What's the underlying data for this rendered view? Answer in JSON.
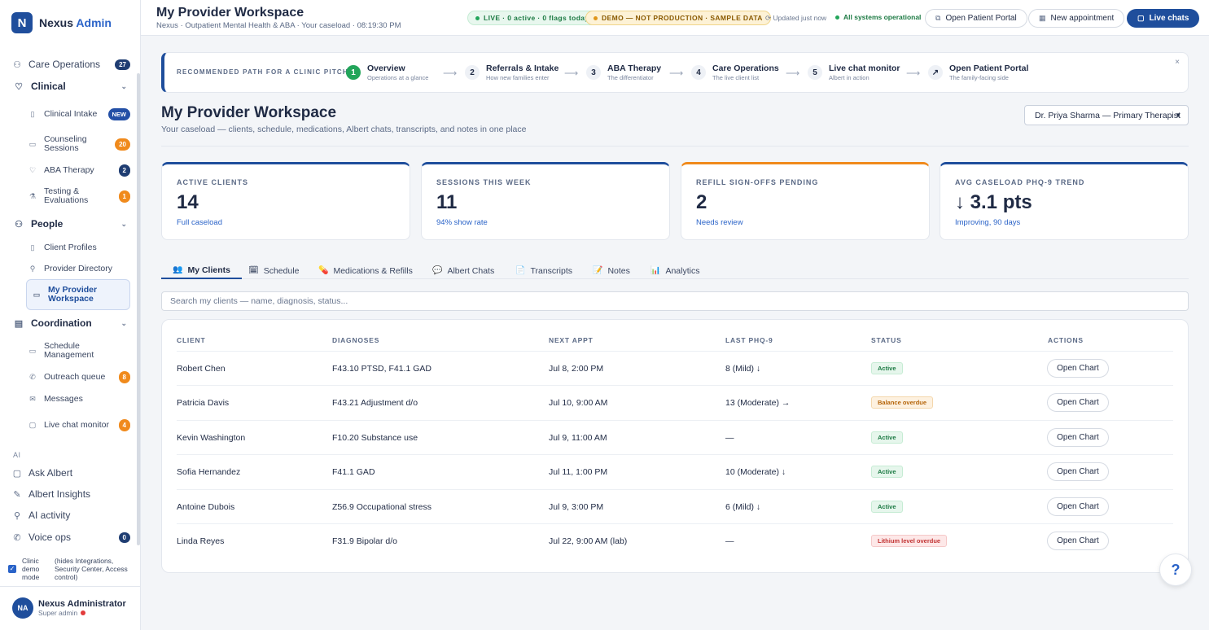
{
  "brand": {
    "logo": "N",
    "name": "Nexus",
    "suffix": "Admin"
  },
  "sidebar": {
    "care_operations": {
      "label": "Care Operations",
      "badge": "27"
    },
    "sections": {
      "clinical": {
        "label": "Clinical"
      },
      "people": {
        "label": "People"
      },
      "coordination": {
        "label": "Coordination"
      }
    },
    "clinical_items": [
      {
        "label": "Clinical Intake",
        "badge": "NEW"
      },
      {
        "label": "Counseling Sessions",
        "badge": "20"
      },
      {
        "label": "ABA Therapy",
        "badge": "2"
      },
      {
        "label": "Testing & Evaluations",
        "badge": "1"
      }
    ],
    "people_items": [
      {
        "label": "Client Profiles"
      },
      {
        "label": "Provider Directory"
      },
      {
        "label": "My Provider Workspace"
      }
    ],
    "coordination_items": [
      {
        "label": "Schedule Management"
      },
      {
        "label": "Outreach queue",
        "badge": "8"
      },
      {
        "label": "Messages"
      },
      {
        "label": "Live chat monitor",
        "badge": "4"
      }
    ],
    "ai_label": "AI",
    "ai_items": [
      {
        "label": "Ask Albert"
      },
      {
        "label": "Albert Insights"
      },
      {
        "label": "AI activity"
      },
      {
        "label": "Voice ops",
        "badge": "0"
      }
    ],
    "demo": {
      "label": "Clinic demo mode",
      "note": "(hides Integrations, Security Center, Access control)"
    },
    "user": {
      "initials": "NA",
      "name": "Nexus Administrator",
      "role": "Super admin"
    }
  },
  "header": {
    "title": "My Provider Workspace",
    "subtitle": "Nexus · Outpatient Mental Health & ABA · Your caseload · 08:19:30 PM",
    "live_pill": "LIVE · 0 active · 0 flags today",
    "demo_pill": "DEMO — NOT PRODUCTION · SAMPLE DATA",
    "updated": "Updated",
    "updated_when": "just now",
    "systems": "All systems operational",
    "buttons": {
      "portal": "Open Patient Portal",
      "appointment": "New appointment",
      "chats": "Live chats"
    }
  },
  "path": {
    "label": "RECOMMENDED PATH FOR A CLINIC PITCH",
    "steps": [
      {
        "num": "1",
        "title": "Overview",
        "sub": "Operations at a glance"
      },
      {
        "num": "2",
        "title": "Referrals & Intake",
        "sub": "How new families enter"
      },
      {
        "num": "3",
        "title": "ABA Therapy",
        "sub": "The differentiator"
      },
      {
        "num": "4",
        "title": "Care Operations",
        "sub": "The live client list"
      },
      {
        "num": "5",
        "title": "Live chat monitor",
        "sub": "Albert in action"
      },
      {
        "num": "↗",
        "title": "Open Patient Portal",
        "sub": "The family-facing side"
      }
    ],
    "arrow": "⟶",
    "close": "×"
  },
  "workspace": {
    "title": "My Provider Workspace",
    "subtitle": "Your caseload — clients, schedule, medications, Albert chats, transcripts, and notes in one place",
    "provider": "Dr. Priya Sharma — Primary Therapist"
  },
  "stats": [
    {
      "label": "ACTIVE CLIENTS",
      "value": "14",
      "note": "Full caseload"
    },
    {
      "label": "SESSIONS THIS WEEK",
      "value": "11",
      "note": "94% show rate"
    },
    {
      "label": "REFILL SIGN-OFFS PENDING",
      "value": "2",
      "note": "Needs review"
    },
    {
      "label": "AVG CASELOAD PHQ-9 TREND",
      "value": "↓ 3.1 pts",
      "note": "Improving, 90 days"
    }
  ],
  "tabs": [
    {
      "icon": "👥",
      "label": "My Clients"
    },
    {
      "icon": "🗓",
      "label": "Schedule"
    },
    {
      "icon": "💊",
      "label": "Medications & Refills"
    },
    {
      "icon": "💬",
      "label": "Albert Chats"
    },
    {
      "icon": "📄",
      "label": "Transcripts"
    },
    {
      "icon": "📝",
      "label": "Notes"
    },
    {
      "icon": "📊",
      "label": "Analytics"
    }
  ],
  "search": {
    "placeholder": "Search my clients — name, diagnosis, status..."
  },
  "table": {
    "headers": [
      "CLIENT",
      "DIAGNOSES",
      "NEXT APPT",
      "LAST PHQ-9",
      "STATUS",
      "ACTIONS"
    ],
    "action_label": "Open Chart",
    "rows": [
      {
        "client": "Robert Chen",
        "dx": "F43.10 PTSD, F41.1 GAD",
        "appt": "Jul 8, 2:00 PM",
        "phq": "8 (Mild) ↓",
        "status": "Active",
        "kind": "active"
      },
      {
        "client": "Patricia Davis",
        "dx": "F43.21 Adjustment d/o",
        "appt": "Jul 10, 9:00 AM",
        "phq": "13 (Moderate) →",
        "status": "Balance overdue",
        "kind": "overdue"
      },
      {
        "client": "Kevin Washington",
        "dx": "F10.20 Substance use",
        "appt": "Jul 9, 11:00 AM",
        "phq": "—",
        "status": "Active",
        "kind": "active"
      },
      {
        "client": "Sofia Hernandez",
        "dx": "F41.1 GAD",
        "appt": "Jul 11, 1:00 PM",
        "phq": "10 (Moderate) ↓",
        "status": "Active",
        "kind": "active"
      },
      {
        "client": "Antoine Dubois",
        "dx": "Z56.9 Occupational stress",
        "appt": "Jul 9, 3:00 PM",
        "phq": "6 (Mild) ↓",
        "status": "Active",
        "kind": "active"
      },
      {
        "client": "Linda Reyes",
        "dx": "F31.9 Bipolar d/o",
        "appt": "Jul 22, 9:00 AM (lab)",
        "phq": "—",
        "status": "Lithium level overdue",
        "kind": "danger"
      }
    ]
  },
  "help": "?"
}
